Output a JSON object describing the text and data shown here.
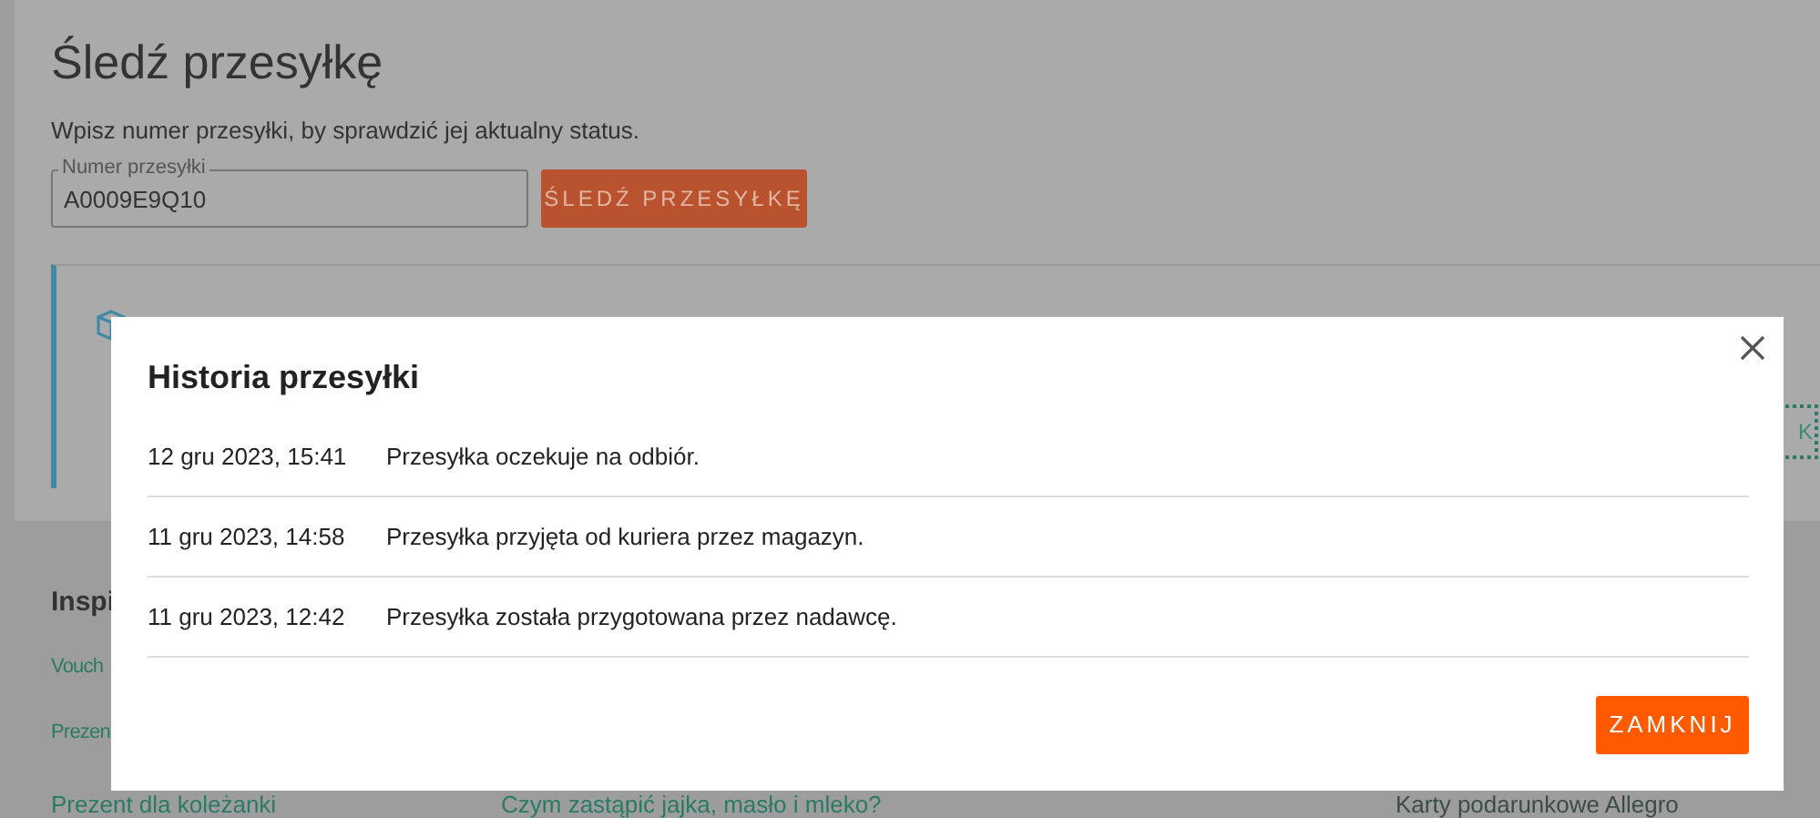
{
  "page": {
    "title": "Śledź przesyłkę",
    "description": "Wpisz numer przesyłki, by sprawdzić jej aktualny status.",
    "tracking_field": {
      "label": "Numer przesyłki",
      "value": "A0009E9Q10"
    },
    "track_button": "ŚLEDŹ PRZESYŁKĘ",
    "result_button": "K"
  },
  "inspirations": {
    "heading": "Inspi",
    "links": [
      {
        "label": "Vouch"
      },
      {
        "label": "Prezen"
      }
    ],
    "bottom_links": [
      "Prezent dla koleżanki",
      "Czym zastąpić jajka, masło i mleko?",
      "Karty podarunkowe Allegro"
    ]
  },
  "dialog": {
    "title": "Historia przesyłki",
    "events": [
      {
        "date": "12 gru 2023, 15:41",
        "status": "Przesyłka oczekuje na odbiór."
      },
      {
        "date": "11 gru 2023, 14:58",
        "status": "Przesyłka przyjęta od kuriera przez magazyn."
      },
      {
        "date": "11 gru 2023, 12:42",
        "status": "Przesyłka została przygotowana przez nadawcę."
      }
    ],
    "close_button": "ZAMKNIJ"
  }
}
